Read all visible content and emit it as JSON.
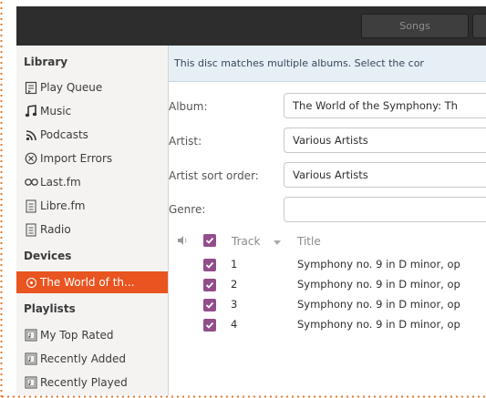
{
  "header": {
    "songs_tab": "Songs"
  },
  "sidebar": {
    "library_heading": "Library",
    "library_items": [
      {
        "label": "Play Queue",
        "icon": "play-queue-icon"
      },
      {
        "label": "Music",
        "icon": "music-note-icon"
      },
      {
        "label": "Podcasts",
        "icon": "rss-icon"
      },
      {
        "label": "Import Errors",
        "icon": "error-circle-icon"
      },
      {
        "label": "Last.fm",
        "icon": "lastfm-icon"
      },
      {
        "label": "Libre.fm",
        "icon": "document-icon"
      },
      {
        "label": "Radio",
        "icon": "radio-icon"
      }
    ],
    "devices_heading": "Devices",
    "device_item": {
      "label": "The World of th...",
      "icon": "disc-icon"
    },
    "playlists_heading": "Playlists",
    "playlist_items": [
      {
        "label": "My Top Rated",
        "icon": "playlist-icon"
      },
      {
        "label": "Recently Added",
        "icon": "playlist-icon"
      },
      {
        "label": "Recently Played",
        "icon": "playlist-icon"
      }
    ]
  },
  "main": {
    "info_message": "This disc matches multiple albums. Select the cor",
    "album_label": "Album:",
    "album_value": "The World of the Symphony: Th",
    "artist_label": "Artist:",
    "artist_value": "Various Artists",
    "artist_sort_label": "Artist sort order:",
    "artist_sort_value": "Various Artists",
    "genre_label": "Genre:",
    "genre_value": "",
    "columns": {
      "track": "Track",
      "title": "Title"
    },
    "tracks": [
      {
        "number": "1",
        "title": "Symphony no. 9 in D minor, op"
      },
      {
        "number": "2",
        "title": "Symphony no. 9 in D minor, op"
      },
      {
        "number": "3",
        "title": "Symphony no. 9 in D minor, op"
      },
      {
        "number": "4",
        "title": "Symphony no. 9 in D minor, op"
      }
    ]
  },
  "colors": {
    "accent": "#e95420",
    "checkbox": "#924d8b",
    "headerbar": "#2d2d2d",
    "infobar": "#e6eff6"
  }
}
